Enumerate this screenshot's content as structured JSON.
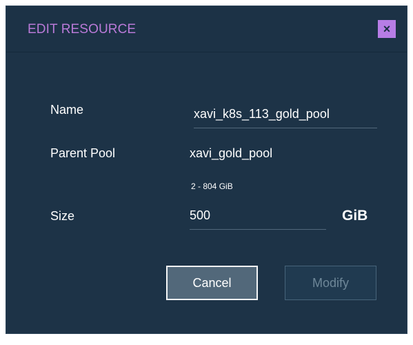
{
  "modal": {
    "title": "EDIT RESOURCE",
    "close_label": "×"
  },
  "form": {
    "name": {
      "label": "Name",
      "value": "xavi_k8s_113_gold_pool"
    },
    "parent_pool": {
      "label": "Parent Pool",
      "value": "xavi_gold_pool"
    },
    "size": {
      "label": "Size",
      "range_hint": "2 - 804 GiB",
      "value": "500",
      "unit": "GiB"
    }
  },
  "actions": {
    "cancel_label": "Cancel",
    "modify_label": "Modify"
  },
  "colors": {
    "modal_background": "#1d3347",
    "title": "#ba7ad8",
    "close_button": "#b77de6",
    "text": "#ffffff",
    "disabled_text": "#6e8798"
  }
}
